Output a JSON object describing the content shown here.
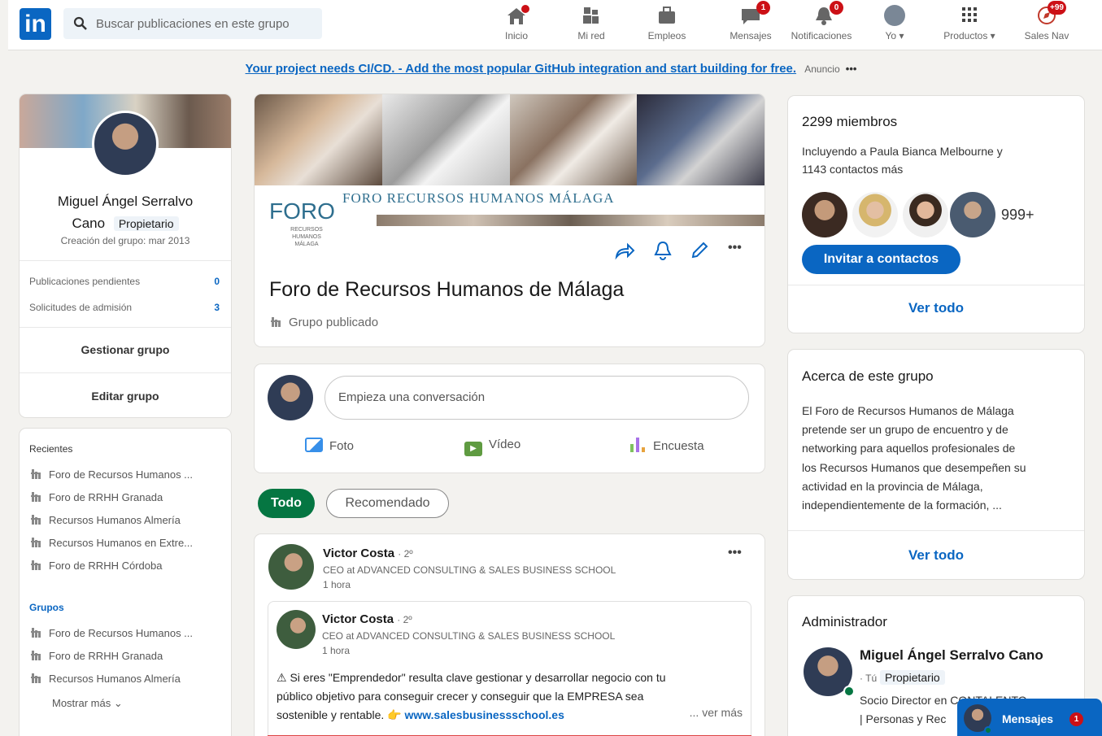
{
  "header": {
    "logo_text": "in",
    "search_placeholder": "Buscar publicaciones en este grupo",
    "nav": [
      {
        "label": "Inicio",
        "icon": "home-icon",
        "badge": ""
      },
      {
        "label": "Mi red",
        "icon": "network-icon",
        "badge": ""
      },
      {
        "label": "Empleos",
        "icon": "briefcase-icon",
        "badge": ""
      },
      {
        "label": "Mensajes",
        "icon": "message-icon",
        "badge": "1"
      },
      {
        "label": "Notificaciones",
        "icon": "bell-icon",
        "badge": "0"
      },
      {
        "label": "Yo ▾",
        "icon": "avatar-icon",
        "badge": ""
      },
      {
        "label": "Productos ▾",
        "icon": "grid-icon",
        "badge": ""
      },
      {
        "label": "Sales Nav",
        "icon": "compass-icon",
        "badge": "+99"
      }
    ]
  },
  "ad": {
    "text": "Your project needs CI/CD. - Add the most popular GitHub integration and start building for free.",
    "tag": "Anuncio",
    "more": "•••"
  },
  "left": {
    "name_line1": "Miguel Ángel Serralvo",
    "name_line2": "Cano",
    "role_badge": "Propietario",
    "created": "Creación del grupo: mar 2013",
    "stats": [
      {
        "label": "Publicaciones pendientes",
        "value": "0"
      },
      {
        "label": "Solicitudes de admisión",
        "value": "3"
      }
    ],
    "manage": "Gestionar grupo",
    "edit": "Editar grupo",
    "recent_title": "Recientes",
    "recent": [
      "Foro de Recursos Humanos ...",
      "Foro de RRHH Granada",
      "Recursos Humanos Almería",
      "Recursos Humanos en Extre...",
      "Foro de RRHH Córdoba"
    ],
    "groups_title": "Grupos",
    "groups": [
      "Foro de Recursos Humanos ...",
      "Foro de RRHH Granada",
      "Recursos Humanos Almería"
    ],
    "show_more": "Mostrar más"
  },
  "group": {
    "banner_title": "FORO RECURSOS HUMANOS MÁLAGA",
    "logo_big": "FORO",
    "logo_sub": "RECURSOS HUMANOS MÁLAGA",
    "name": "Foro de Recursos Humanos de Málaga",
    "type": "Grupo publicado",
    "more": "•••"
  },
  "composer": {
    "placeholder": "Empieza una conversación",
    "photo": "Foto",
    "video": "Vídeo",
    "poll": "Encuesta"
  },
  "filters": {
    "all": "Todo",
    "recommended": "Recomendado"
  },
  "post": {
    "author": "Victor Costa",
    "degree": "· 2º",
    "headline": "CEO at ADVANCED CONSULTING & SALES BUSINESS SCHOOL",
    "time": "1 hora",
    "more": "•••",
    "inner_author": "Victor Costa",
    "inner_degree": "· 2º",
    "inner_headline": "CEO at ADVANCED CONSULTING & SALES BUSINESS SCHOOL",
    "inner_time": "1 hora",
    "text1": "⚠ Si eres \"Emprendedor\" resulta clave gestionar y desarrollar negocio con tu",
    "text2": "público objetivo para conseguir crecer y conseguir que la EMPRESA sea",
    "text3": "sostenible y rentable. 👉",
    "link": "www.salesbusinessschool.es",
    "see_more": "... ver más"
  },
  "members": {
    "count": "2299 miembros",
    "including1": "Incluyendo a Paula Bianca Melbourne y",
    "including2": "1143 contactos más",
    "extra": "999+",
    "invite": "Invitar a contactos",
    "see_all": "Ver todo"
  },
  "about": {
    "title": "Acerca de este grupo",
    "lines": [
      "El Foro de Recursos Humanos de Málaga",
      "pretende ser un grupo de encuentro y de",
      "networking para aquellos profesionales de",
      "los Recursos Humanos que desempeñen su",
      "actividad en la provincia de Málaga,",
      "independientemente de la formación, ..."
    ],
    "see_all": "Ver todo"
  },
  "admin": {
    "title": "Administrador",
    "name": "Miguel Ángel Serralvo Cano",
    "you": "· Tú",
    "role": "Propietario",
    "line1": "Socio Director en CONTALENTO",
    "line2": "| Personas y Rec"
  },
  "messaging": {
    "label": "Mensajes",
    "badge": "1"
  }
}
